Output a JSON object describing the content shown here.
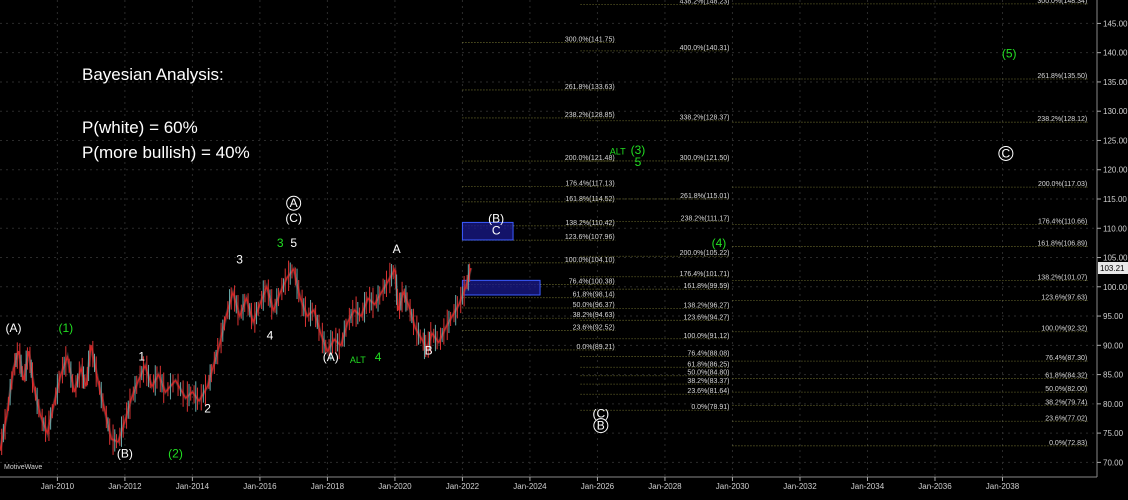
{
  "annotation": {
    "title": "Bayesian Analysis:",
    "line1": "P(white) = 60%",
    "line2": "P(more bullish) = 40%"
  },
  "watermark": "MotiveWave",
  "chart_data": {
    "type": "line",
    "x_ticks": [
      "Jan-2010",
      "Jan-2012",
      "Jan-2014",
      "Jan-2016",
      "Jan-2018",
      "Jan-2020",
      "Jan-2022",
      "Jan-2024",
      "Jan-2026",
      "Jan-2028",
      "Jan-2030",
      "Jan-2032",
      "Jan-2034",
      "Jan-2036",
      "Jan-2038"
    ],
    "x_range": [
      2008.3,
      2040.8
    ],
    "y_ticks": [
      70,
      75,
      80,
      85,
      90,
      95,
      100,
      105,
      110,
      115,
      120,
      125,
      130,
      135,
      140,
      145
    ],
    "y_range": [
      67.5,
      149.0
    ],
    "last_price": "103.21",
    "price_series": [
      [
        2008.3,
        72
      ],
      [
        2008.5,
        78
      ],
      [
        2008.7,
        86
      ],
      [
        2008.85,
        89
      ],
      [
        2009.0,
        84
      ],
      [
        2009.15,
        89
      ],
      [
        2009.3,
        83
      ],
      [
        2009.5,
        78
      ],
      [
        2009.7,
        75
      ],
      [
        2009.9,
        80
      ],
      [
        2010.1,
        85
      ],
      [
        2010.3,
        88
      ],
      [
        2010.5,
        82
      ],
      [
        2010.7,
        86
      ],
      [
        2010.85,
        83
      ],
      [
        2011.0,
        90
      ],
      [
        2011.2,
        84
      ],
      [
        2011.4,
        79
      ],
      [
        2011.6,
        74
      ],
      [
        2011.8,
        73.5
      ],
      [
        2012.0,
        77
      ],
      [
        2012.2,
        81
      ],
      [
        2012.4,
        84
      ],
      [
        2012.6,
        86.5
      ],
      [
        2012.8,
        83
      ],
      [
        2013.0,
        85
      ],
      [
        2013.2,
        82
      ],
      [
        2013.5,
        84
      ],
      [
        2013.8,
        81
      ],
      [
        2014.0,
        82
      ],
      [
        2014.2,
        80.5
      ],
      [
        2014.45,
        83
      ],
      [
        2014.6,
        86
      ],
      [
        2014.8,
        90
      ],
      [
        2015.0,
        95
      ],
      [
        2015.2,
        99
      ],
      [
        2015.4,
        95
      ],
      [
        2015.6,
        98
      ],
      [
        2015.8,
        94
      ],
      [
        2016.0,
        97
      ],
      [
        2016.2,
        100
      ],
      [
        2016.4,
        96
      ],
      [
        2016.6,
        99
      ],
      [
        2016.8,
        101.5
      ],
      [
        2017.0,
        103
      ],
      [
        2017.2,
        98
      ],
      [
        2017.4,
        95
      ],
      [
        2017.6,
        96
      ],
      [
        2017.8,
        92
      ],
      [
        2018.0,
        89
      ],
      [
        2018.2,
        91
      ],
      [
        2018.4,
        90
      ],
      [
        2018.6,
        94
      ],
      [
        2018.8,
        96
      ],
      [
        2019.0,
        95
      ],
      [
        2019.2,
        98
      ],
      [
        2019.4,
        97
      ],
      [
        2019.6,
        99
      ],
      [
        2019.8,
        101
      ],
      [
        2020.0,
        103
      ],
      [
        2020.1,
        96
      ],
      [
        2020.25,
        99
      ],
      [
        2020.4,
        97
      ],
      [
        2020.6,
        93
      ],
      [
        2020.8,
        91
      ],
      [
        2020.95,
        89.5
      ],
      [
        2021.1,
        92
      ],
      [
        2021.3,
        90.5
      ],
      [
        2021.5,
        93
      ],
      [
        2021.7,
        95
      ],
      [
        2021.9,
        97
      ],
      [
        2022.1,
        100
      ],
      [
        2022.25,
        103.2
      ]
    ],
    "wave_labels": [
      {
        "text": "(A)",
        "x": 2008.7,
        "y": 92.3,
        "color": "#ffffff"
      },
      {
        "text": "(1)",
        "x": 2010.25,
        "y": 92.3,
        "color": "#22dd22"
      },
      {
        "text": "1",
        "x": 2012.5,
        "y": 87.4,
        "color": "#ffffff"
      },
      {
        "text": "2",
        "x": 2014.45,
        "y": 78.5,
        "color": "#ffffff"
      },
      {
        "text": "(B)",
        "x": 2012.0,
        "y": 70.8,
        "color": "#ffffff"
      },
      {
        "text": "(2)",
        "x": 2013.5,
        "y": 70.8,
        "color": "#22dd22"
      },
      {
        "text": "3",
        "x": 2015.4,
        "y": 104.0,
        "color": "#ffffff"
      },
      {
        "text": "3",
        "x": 2016.6,
        "y": 106.8,
        "color": "#22dd22"
      },
      {
        "text": "4",
        "x": 2016.3,
        "y": 91.0,
        "color": "#ffffff"
      },
      {
        "text": "A",
        "x": 2017.0,
        "y": 113.6,
        "color": "#ffffff",
        "circled": true
      },
      {
        "text": "(C)",
        "x": 2017.0,
        "y": 111.1,
        "color": "#ffffff"
      },
      {
        "text": "5",
        "x": 2017.0,
        "y": 106.8,
        "color": "#ffffff"
      },
      {
        "text": "(A)",
        "x": 2018.1,
        "y": 87.3,
        "color": "#ffffff"
      },
      {
        "text": "ALT",
        "x": 2018.9,
        "y": 87.0,
        "color": "#22dd22",
        "small": true
      },
      {
        "text": "4",
        "x": 2019.5,
        "y": 87.3,
        "color": "#22dd22"
      },
      {
        "text": "A",
        "x": 2020.05,
        "y": 105.8,
        "color": "#ffffff"
      },
      {
        "text": "B",
        "x": 2021.0,
        "y": 88.4,
        "color": "#ffffff"
      },
      {
        "text": "(B)",
        "x": 2023.0,
        "y": 111.0,
        "color": "#ffffff"
      },
      {
        "text": "C",
        "x": 2023.0,
        "y": 108.9,
        "color": "#ffffff"
      },
      {
        "text": "ALT",
        "x": 2026.6,
        "y": 122.6,
        "color": "#22dd22",
        "small": true
      },
      {
        "text": "(3)",
        "x": 2027.2,
        "y": 122.7,
        "color": "#22dd22"
      },
      {
        "text": "5",
        "x": 2027.2,
        "y": 120.6,
        "color": "#22dd22"
      },
      {
        "text": "(4)",
        "x": 2029.6,
        "y": 106.8,
        "color": "#22dd22"
      },
      {
        "text": "(5)",
        "x": 2038.2,
        "y": 139.2,
        "color": "#22dd22"
      },
      {
        "text": "C",
        "x": 2038.1,
        "y": 122.1,
        "color": "#ffffff",
        "circled": true
      },
      {
        "text": "(C)",
        "x": 2026.1,
        "y": 77.7,
        "color": "#ffffff"
      },
      {
        "text": "B",
        "x": 2026.1,
        "y": 75.6,
        "color": "#ffffff",
        "circled": true
      }
    ],
    "fib_groups": [
      {
        "x_from": 2022.0,
        "x_to": 2024.3,
        "text_x": 2026.6,
        "levels": [
          {
            "label": "300.0%(141.75)",
            "y": 141.75
          },
          {
            "label": "261.8%(133.63)",
            "y": 133.63
          },
          {
            "label": "238.2%(128.85)",
            "y": 128.85
          },
          {
            "label": "200.0%(121.48)",
            "y": 121.48
          },
          {
            "label": "176.4%(117.13)",
            "y": 117.13
          },
          {
            "label": "161.8%(114.52)",
            "y": 114.52
          },
          {
            "label": "138.2%(110.42)",
            "y": 110.42
          },
          {
            "label": "123.6%(107.96)",
            "y": 107.96
          },
          {
            "label": "100.0%(104.10)",
            "y": 104.1
          },
          {
            "label": "76.4%(100.38)",
            "y": 100.38
          },
          {
            "label": "61.8%(98.14)",
            "y": 98.14
          },
          {
            "label": "50.0%(96.37)",
            "y": 96.37
          },
          {
            "label": "38.2%(94.63)",
            "y": 94.63
          },
          {
            "label": "23.6%(92.52)",
            "y": 92.52
          },
          {
            "label": "0.0%(89.21)",
            "y": 89.21
          }
        ]
      },
      {
        "x_from": 2025.5,
        "x_to": 2028.2,
        "text_x": 2030.0,
        "levels": [
          {
            "label": "438.2%(148.23)",
            "y": 148.23
          },
          {
            "label": "400.0%(140.31)",
            "y": 140.31
          },
          {
            "label": "338.2%(128.37)",
            "y": 128.37
          },
          {
            "label": "300.0%(121.50)",
            "y": 121.5
          },
          {
            "label": "261.8%(115.01)",
            "y": 115.01
          },
          {
            "label": "238.2%(111.17)",
            "y": 111.17
          },
          {
            "label": "200.0%(105.22)",
            "y": 105.22
          },
          {
            "label": "176.4%(101.71)",
            "y": 101.71
          },
          {
            "label": "161.8%(99.59)",
            "y": 99.59
          },
          {
            "label": "138.2%(96.27)",
            "y": 96.27
          },
          {
            "label": "123.6%(94.27)",
            "y": 94.27
          },
          {
            "label": "100.0%(91.12)",
            "y": 91.12
          },
          {
            "label": "76.4%(88.08)",
            "y": 88.08
          },
          {
            "label": "61.8%(86.25)",
            "y": 86.25
          },
          {
            "label": "50.0%(84.80)",
            "y": 84.8
          },
          {
            "label": "38.2%(83.37)",
            "y": 83.37
          },
          {
            "label": "23.6%(81.64)",
            "y": 81.64
          },
          {
            "label": "0.0%(78.91)",
            "y": 78.91
          }
        ]
      },
      {
        "x_from": 2030.0,
        "x_to": 2034.8,
        "text_x": 2040.6,
        "levels": [
          {
            "label": "300.0%(148.34)",
            "y": 148.34
          },
          {
            "label": "261.8%(135.50)",
            "y": 135.5
          },
          {
            "label": "238.2%(128.12)",
            "y": 128.12
          },
          {
            "label": "200.0%(117.03)",
            "y": 117.03
          },
          {
            "label": "176.4%(110.66)",
            "y": 110.66
          },
          {
            "label": "161.8%(106.89)",
            "y": 106.89
          },
          {
            "label": "138.2%(101.07)",
            "y": 101.07
          },
          {
            "label": "123.6%(97.63)",
            "y": 97.63
          },
          {
            "label": "100.0%(92.32)",
            "y": 92.32
          },
          {
            "label": "76.4%(87.30)",
            "y": 87.3
          },
          {
            "label": "61.8%(84.32)",
            "y": 84.32
          },
          {
            "label": "50.0%(82.00)",
            "y": 82.0
          },
          {
            "label": "38.2%(79.74)",
            "y": 79.74
          },
          {
            "label": "23.6%(77.02)",
            "y": 77.02
          },
          {
            "label": "0.0%(72.83)",
            "y": 72.83
          }
        ]
      }
    ],
    "target_boxes": [
      {
        "x_from": 2022.0,
        "x_to": 2023.5,
        "y_low": 108.0,
        "y_high": 111.0
      },
      {
        "x_from": 2022.0,
        "x_to": 2024.3,
        "y_low": 98.6,
        "y_high": 101.1
      }
    ],
    "colors": {
      "background": "#000000",
      "price": "#cc2222",
      "grid": "#2b2b2b",
      "fib_line": "#8a8a3a",
      "box_fill": "#1a1a8c",
      "box_border": "#3b5bff",
      "axis_text": "#cfcfcf"
    }
  }
}
